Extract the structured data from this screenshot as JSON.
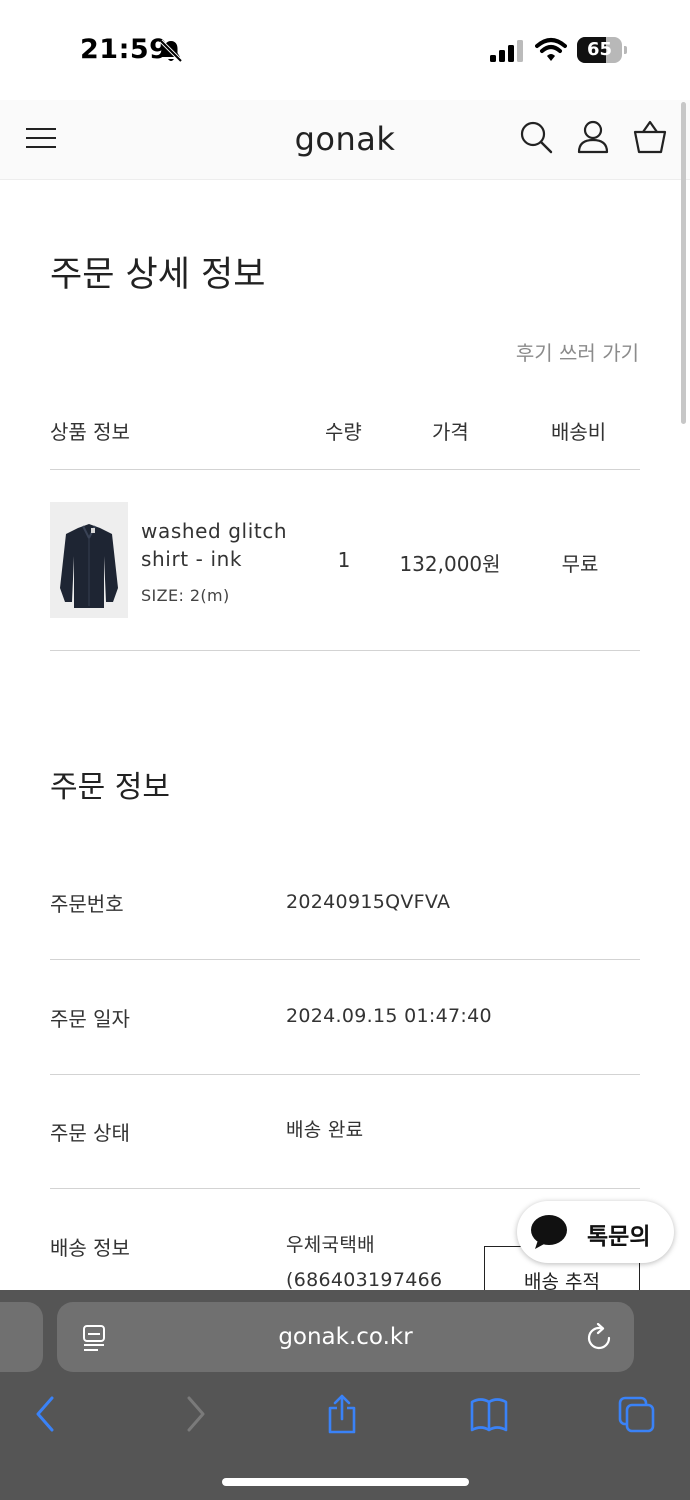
{
  "status_bar": {
    "time": "21:59",
    "battery": "65",
    "battery_level": 0.65
  },
  "header": {
    "logo": "gonak"
  },
  "page": {
    "title": "주문 상세 정보",
    "review_link": "후기 쓰러 가기"
  },
  "product_table": {
    "headers": {
      "product": "상품 정보",
      "quantity": "수량",
      "price": "가격",
      "shipping": "배송비"
    },
    "items": [
      {
        "name": "washed glitch shirt - ink",
        "option": "SIZE: 2(m)",
        "quantity": "1",
        "price": "132,000원",
        "shipping": "무료"
      }
    ]
  },
  "order_info": {
    "title": "주문 정보",
    "rows": [
      {
        "label": "주문번호",
        "value": "20240915QVFVA"
      },
      {
        "label": "주문 일자",
        "value": "2024.09.15 01:47:40"
      },
      {
        "label": "주문 상태",
        "value": "배송 완료"
      },
      {
        "label": "배송 정보",
        "value": "우체국택배",
        "value2": "(686403197466"
      }
    ],
    "track_button": "배송 추적"
  },
  "chat": {
    "label": "톡문의"
  },
  "browser": {
    "url": "gonak.co.kr"
  },
  "colors": {
    "accent_blue": "#3a82f7",
    "toolbar": "#555555",
    "url_field": "#707070"
  }
}
